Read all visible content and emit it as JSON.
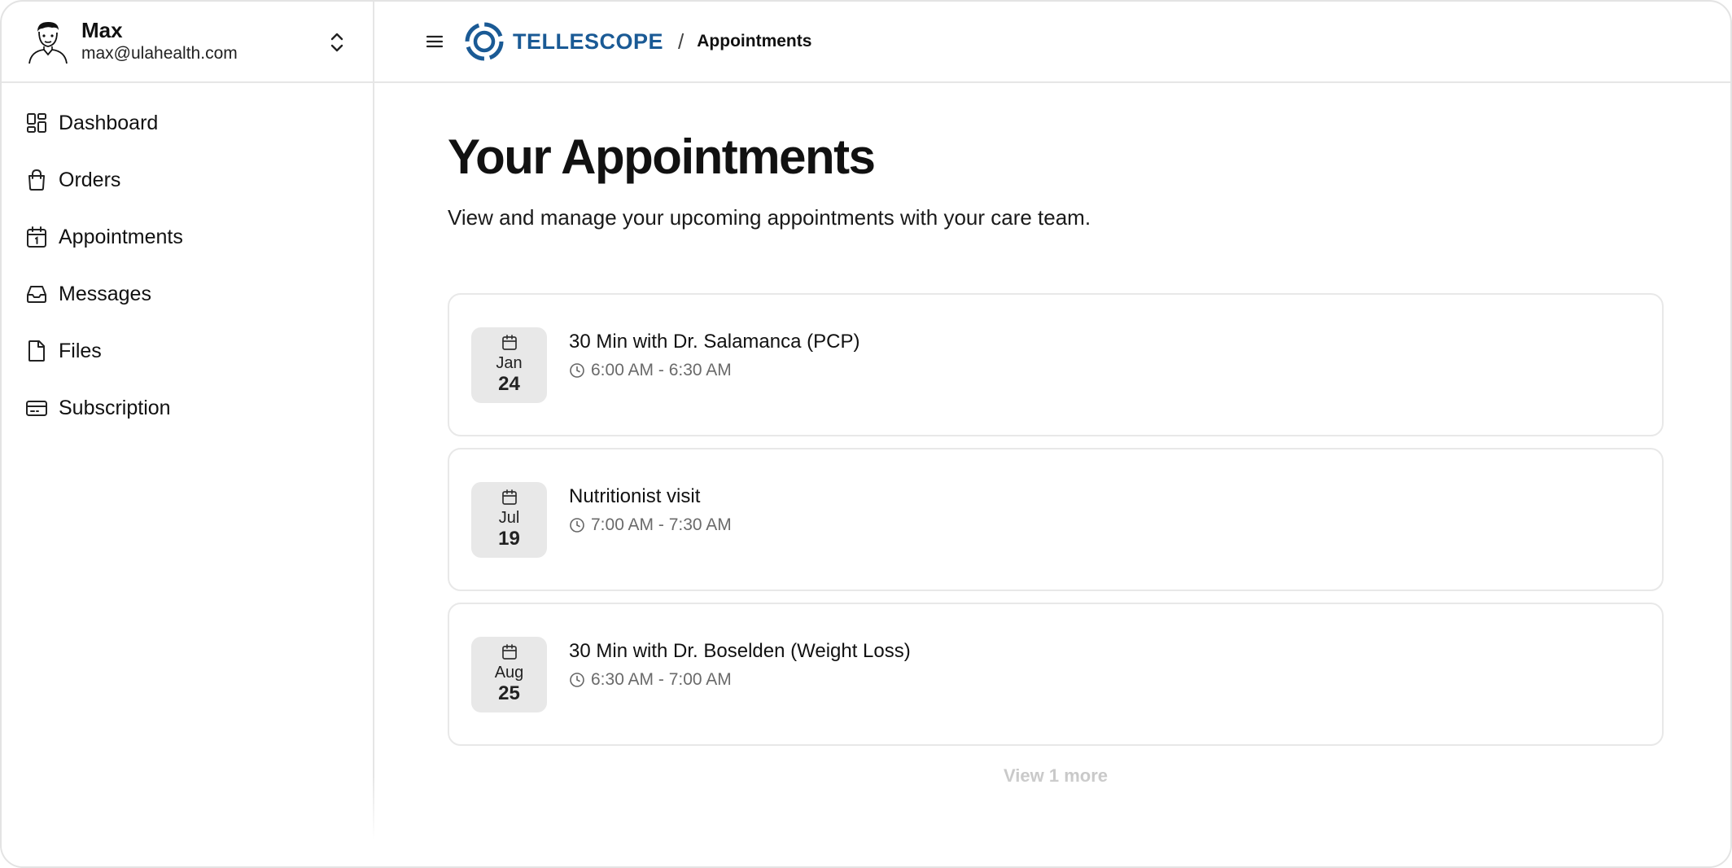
{
  "user": {
    "name": "Max",
    "email": "max@ulahealth.com"
  },
  "sidebar": {
    "items": [
      {
        "label": "Dashboard",
        "icon": "dashboard-icon"
      },
      {
        "label": "Orders",
        "icon": "shopping-bag-icon"
      },
      {
        "label": "Appointments",
        "icon": "calendar-icon"
      },
      {
        "label": "Messages",
        "icon": "inbox-icon"
      },
      {
        "label": "Files",
        "icon": "file-icon"
      },
      {
        "label": "Subscription",
        "icon": "credit-card-icon"
      }
    ]
  },
  "header": {
    "logo_text": "TELLESCOPE",
    "separator": "/",
    "breadcrumb_current": "Appointments"
  },
  "main": {
    "title": "Your Appointments",
    "subtitle": "View and manage your upcoming appointments with your care team.",
    "appointments": [
      {
        "month": "Jan",
        "day": "24",
        "title": "30 Min with Dr. Salamanca (PCP)",
        "time": "6:00 AM - 6:30 AM"
      },
      {
        "month": "Jul",
        "day": "19",
        "title": "Nutritionist visit",
        "time": "7:00 AM - 7:30 AM"
      },
      {
        "month": "Aug",
        "day": "25",
        "title": "30 Min with Dr. Boselden (Weight Loss)",
        "time": "6:30 AM - 7:00 AM"
      }
    ],
    "view_more_label": "View 1 more"
  },
  "colors": {
    "brand": "#1a5a95",
    "date_badge_bg": "#e8e8e8",
    "muted_text": "#6a6a6a",
    "border": "#e6e6e6"
  }
}
